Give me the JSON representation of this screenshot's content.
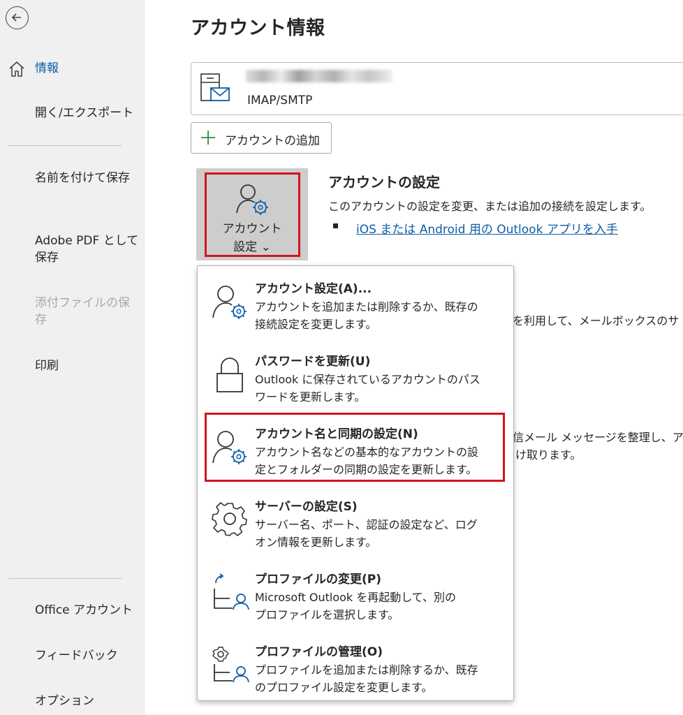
{
  "sidebar": {
    "items": [
      {
        "label": "情報"
      },
      {
        "label": "開く/エクスポート"
      },
      {
        "label": "名前を付けて保存"
      },
      {
        "label": "Adobe PDF として保存"
      },
      {
        "label": "添付ファイルの保存"
      },
      {
        "label": "印刷"
      },
      {
        "label": "Office アカウント"
      },
      {
        "label": "フィードバック"
      },
      {
        "label": "オプション"
      }
    ],
    "icons": {
      "back": "back-arrow-icon",
      "home": "home-icon"
    }
  },
  "main": {
    "title": "アカウント情報",
    "account": {
      "type": "IMAP/SMTP"
    },
    "add_account_label": "アカウントの追加",
    "settings_button": {
      "line1": "アカウント",
      "line2": "設定 ⌄"
    },
    "section": {
      "title": "アカウントの設定",
      "desc": "このアカウントの設定を変更、または追加の接続を設定します。",
      "link": "iOS または Android 用の Outlook アプリを入手"
    },
    "background_text": {
      "line1": "理を利用して、メールボックスのサ",
      "line2": "受信メール メッセージを整理し、ア",
      "line3": "け取ります。"
    }
  },
  "menu": {
    "items": [
      {
        "title": "アカウント設定(A)...",
        "desc1": "アカウントを追加または削除するか、既存の",
        "desc2": "接続設定を変更します。",
        "icon": "account-settings-icon"
      },
      {
        "title": "パスワードを更新(U)",
        "desc1": "Outlook に保存されているアカウントのパス",
        "desc2": "ワードを更新します。",
        "icon": "lock-icon"
      },
      {
        "title": "アカウント名と同期の設定(N)",
        "desc1": "アカウント名などの基本的なアカウントの設",
        "desc2": "定とフォルダーの同期の設定を更新します。",
        "icon": "account-sync-icon"
      },
      {
        "title": "サーバーの設定(S)",
        "desc1": "サーバー名、ポート、認証の設定など、ログ",
        "desc2": "オン情報を更新します。",
        "icon": "gear-icon"
      },
      {
        "title": "プロファイルの変更(P)",
        "desc1": "Microsoft Outlook を再起動して、別の",
        "desc2": "プロファイルを選択します。",
        "icon": "profile-switch-icon"
      },
      {
        "title": "プロファイルの管理(O)",
        "desc1": "プロファイルを追加または削除するか、既存",
        "desc2": "のプロファイル設定を変更します。",
        "icon": "profile-manage-icon"
      }
    ]
  },
  "colors": {
    "accent": "#0f5ea6",
    "highlight": "#d4141f",
    "sidebar_bg": "#f0f0f0"
  }
}
